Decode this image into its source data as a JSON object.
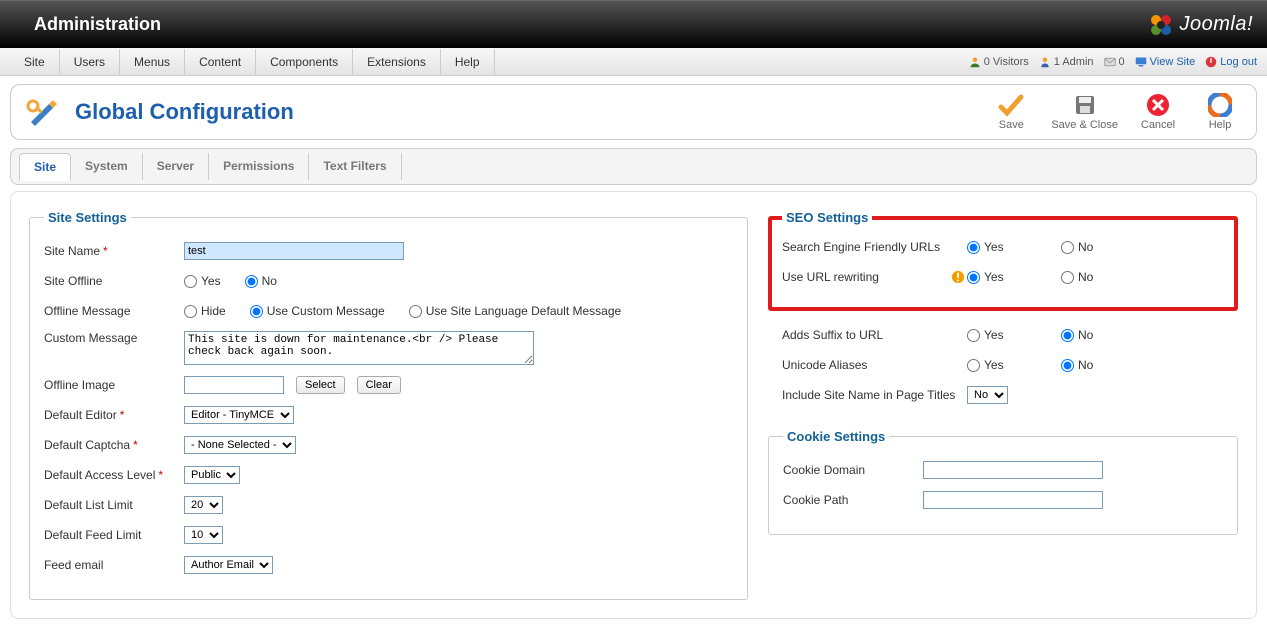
{
  "header": {
    "title": "Administration",
    "brand": "Joomla!"
  },
  "menu": {
    "items": [
      "Site",
      "Users",
      "Menus",
      "Content",
      "Components",
      "Extensions",
      "Help"
    ],
    "status": {
      "visitors": "0 Visitors",
      "admins": "1 Admin",
      "messages": "0",
      "view_site": "View Site",
      "logout": "Log out"
    }
  },
  "page": {
    "title": "Global Configuration"
  },
  "toolbar": {
    "save": "Save",
    "save_close": "Save & Close",
    "cancel": "Cancel",
    "help": "Help"
  },
  "tabs": [
    "Site",
    "System",
    "Server",
    "Permissions",
    "Text Filters"
  ],
  "tabs_active": 0,
  "site": {
    "legend": "Site Settings",
    "site_name_label": "Site Name",
    "site_name_value": "test",
    "site_offline_label": "Site Offline",
    "yes": "Yes",
    "no": "No",
    "offline_msg_label": "Offline Message",
    "offline_msg_hide": "Hide",
    "offline_msg_custom": "Use Custom Message",
    "offline_msg_lang": "Use Site Language Default Message",
    "custom_msg_label": "Custom Message",
    "custom_msg_value": "This site is down for maintenance.<br /> Please check back again soon.",
    "offline_image_label": "Offline Image",
    "select_btn": "Select",
    "clear_btn": "Clear",
    "default_editor_label": "Default Editor",
    "default_editor_value": "Editor - TinyMCE",
    "default_captcha_label": "Default Captcha",
    "default_captcha_value": "- None Selected -",
    "default_access_label": "Default Access Level",
    "default_access_value": "Public",
    "default_list_label": "Default List Limit",
    "default_list_value": "20",
    "default_feed_label": "Default Feed Limit",
    "default_feed_value": "10",
    "feed_email_label": "Feed email",
    "feed_email_value": "Author Email"
  },
  "seo": {
    "legend": "SEO Settings",
    "sef_label": "Search Engine Friendly URLs",
    "rewrite_label": "Use URL rewriting",
    "suffix_label": "Adds Suffix to URL",
    "unicode_label": "Unicode Aliases",
    "sitename_title_label": "Include Site Name in Page Titles",
    "sitename_title_value": "No"
  },
  "cookie": {
    "legend": "Cookie Settings",
    "domain_label": "Cookie Domain",
    "path_label": "Cookie Path"
  }
}
